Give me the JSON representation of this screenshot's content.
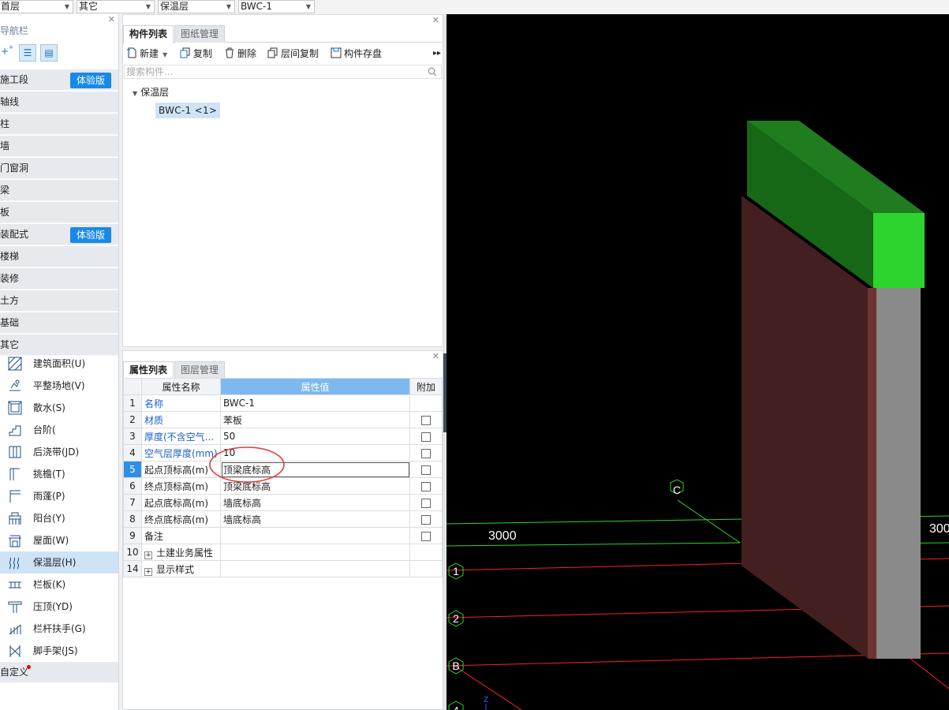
{
  "topbar": {
    "floor": "首层",
    "category": "其它",
    "type": "保温层",
    "component": "BWC-1"
  },
  "nav": {
    "title": "导航栏",
    "badge_label": "体验版",
    "categories": [
      {
        "label": "施工段",
        "badge": true
      },
      {
        "label": "轴线"
      },
      {
        "label": "柱"
      },
      {
        "label": "墙"
      },
      {
        "label": "门窗洞"
      },
      {
        "label": "梁"
      },
      {
        "label": "板"
      },
      {
        "label": "装配式",
        "badge": true
      },
      {
        "label": "楼梯"
      },
      {
        "label": "装修"
      },
      {
        "label": "土方"
      },
      {
        "label": "基础"
      },
      {
        "label": "其它"
      }
    ],
    "subitems": [
      {
        "label": "建筑面积(U)",
        "icon": "area-icon"
      },
      {
        "label": "平整场地(V)",
        "icon": "site-level-icon"
      },
      {
        "label": "散水(S)",
        "icon": "apron-icon"
      },
      {
        "label": "台阶(",
        "icon": "steps-icon"
      },
      {
        "label": "后浇带(JD)",
        "icon": "post-pour-strip-icon"
      },
      {
        "label": "挑檐(T)",
        "icon": "cornice-icon"
      },
      {
        "label": "雨蓬(P)",
        "icon": "canopy-icon"
      },
      {
        "label": "阳台(Y)",
        "icon": "balcony-icon"
      },
      {
        "label": "屋面(W)",
        "icon": "roof-icon"
      },
      {
        "label": "保温层(H)",
        "icon": "insulation-icon",
        "selected": true
      },
      {
        "label": "栏板(K)",
        "icon": "parapet-icon"
      },
      {
        "label": "压顶(YD)",
        "icon": "coping-icon"
      },
      {
        "label": "栏杆扶手(G)",
        "icon": "railing-icon"
      },
      {
        "label": "脚手架(JS)",
        "icon": "scaffold-icon"
      }
    ],
    "custom": "自定义"
  },
  "component_panel": {
    "tabs": [
      "构件列表",
      "图纸管理"
    ],
    "toolbar": {
      "new": "新建",
      "copy": "复制",
      "delete": "删除",
      "floor_copy": "层间复制",
      "save": "构件存盘"
    },
    "search_placeholder": "搜索构件...",
    "tree_root": "保温层",
    "tree_child": "BWC-1 <1>"
  },
  "property_panel": {
    "tabs": [
      "属性列表",
      "图层管理"
    ],
    "headers": {
      "name": "属性名称",
      "value": "属性值",
      "extra": "附加"
    },
    "rows": [
      {
        "num": "1",
        "name": "名称",
        "value": "BWC-1",
        "blue": true,
        "checkbox": false
      },
      {
        "num": "2",
        "name": "材质",
        "value": "苯板",
        "blue": true,
        "checkbox": true
      },
      {
        "num": "3",
        "name": "厚度(不含空气...",
        "value": "50",
        "blue": true,
        "checkbox": true
      },
      {
        "num": "4",
        "name": "空气层厚度(mm)",
        "value": "10",
        "blue": true,
        "checkbox": true
      },
      {
        "num": "5",
        "name": "起点顶标高(m)",
        "value": "顶梁底标高",
        "blue": false,
        "checkbox": true,
        "selected": true
      },
      {
        "num": "6",
        "name": "终点顶标高(m)",
        "value": "顶梁底标高",
        "blue": false,
        "checkbox": true
      },
      {
        "num": "7",
        "name": "起点底标高(m)",
        "value": "墙底标高",
        "blue": false,
        "checkbox": true
      },
      {
        "num": "8",
        "name": "终点底标高(m)",
        "value": "墙底标高",
        "blue": false,
        "checkbox": true
      },
      {
        "num": "9",
        "name": "备注",
        "value": "",
        "blue": false,
        "checkbox": true
      },
      {
        "num": "10",
        "name": "土建业务属性",
        "value": "",
        "group": true
      },
      {
        "num": "14",
        "name": "显示样式",
        "value": "",
        "group": true
      }
    ]
  },
  "viewport": {
    "dim_left": "3000",
    "dim_right": "300",
    "axis_c": "C",
    "axis_1": "1",
    "axis_2": "2",
    "axis_b": "B",
    "axis_4": "4",
    "z_label": "Z",
    "colors": {
      "grid_green": "#2bd62b",
      "grid_red": "#ff1f1f",
      "wall": "#43201f",
      "beam_top": "#1f7d1f",
      "beam_end": "#2ed42e",
      "insulation": "#8a8a8a"
    }
  }
}
